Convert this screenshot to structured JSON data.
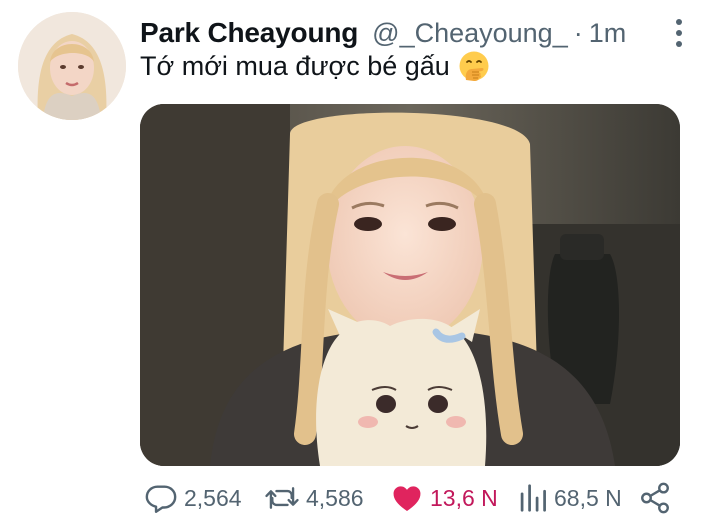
{
  "tweet": {
    "author_name": "Park Cheayoung",
    "handle": "@_Cheayoung_",
    "separator": "·",
    "time": "1m",
    "text": "Tớ mới mua được bé gấu"
  },
  "icons": {
    "more": "more-vertical-icon",
    "emoji": "hand-over-mouth-emoji-icon",
    "reply": "reply-bubble-icon",
    "retweet": "retweet-icon",
    "like": "heart-icon",
    "views": "views-bar-chart-icon",
    "share": "share-icon"
  },
  "actions": {
    "replies": "2,564",
    "retweets": "4,586",
    "likes": "13,6 N",
    "views": "68,5 N"
  },
  "colors": {
    "like_active": "#e0245e",
    "like_text": "#c2185b",
    "muted": "#536471",
    "text": "#0f1419"
  }
}
